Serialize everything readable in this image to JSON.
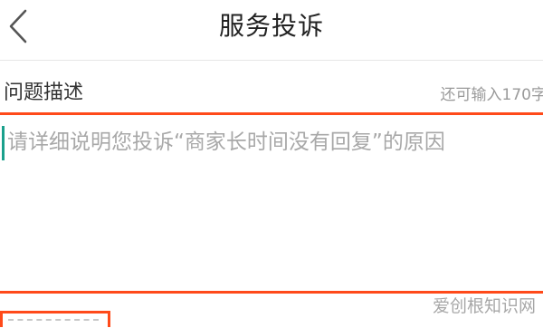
{
  "header": {
    "title": "服务投诉",
    "back_icon": "chevron-left-icon"
  },
  "description": {
    "label": "问题描述",
    "remaining": "还可输入170字",
    "placeholder": "请详细说明您投诉“商家长时间没有回复”的原因",
    "value": ""
  },
  "watermark": {
    "text": "爱创根知识网"
  },
  "colors": {
    "highlight": "#ff4a1a",
    "caret": "#1aa08c",
    "placeholder": "#a8a8a8"
  }
}
